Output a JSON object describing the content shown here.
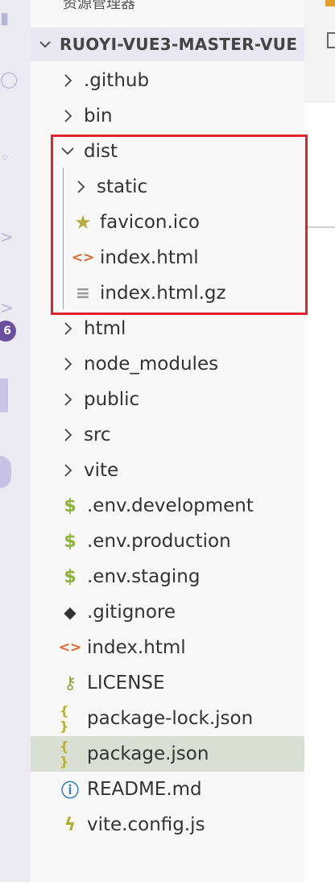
{
  "sidebar": {
    "title": "资源管理器",
    "section_title": "RUOYI-VUE3-MASTER-VUE"
  },
  "activity_bar": {
    "badge_count": "6"
  },
  "tree": [
    {
      "label": ".github",
      "type": "folder",
      "expanded": false,
      "level": 0
    },
    {
      "label": "bin",
      "type": "folder",
      "expanded": false,
      "level": 0
    },
    {
      "label": "dist",
      "type": "folder",
      "expanded": true,
      "level": 0
    },
    {
      "label": "static",
      "type": "folder",
      "expanded": false,
      "level": 1
    },
    {
      "label": "favicon.ico",
      "type": "file",
      "icon": "star-icon",
      "level": 1
    },
    {
      "label": "index.html",
      "type": "file",
      "icon": "html-code-icon",
      "level": 1
    },
    {
      "label": "index.html.gz",
      "type": "file",
      "icon": "text-file-icon",
      "level": 1
    },
    {
      "label": "html",
      "type": "folder",
      "expanded": false,
      "level": 0
    },
    {
      "label": "node_modules",
      "type": "folder",
      "expanded": false,
      "level": 0
    },
    {
      "label": "public",
      "type": "folder",
      "expanded": false,
      "level": 0
    },
    {
      "label": "src",
      "type": "folder",
      "expanded": false,
      "level": 0
    },
    {
      "label": "vite",
      "type": "folder",
      "expanded": false,
      "level": 0
    },
    {
      "label": ".env.development",
      "type": "file",
      "icon": "dollar-icon",
      "level": 0
    },
    {
      "label": ".env.production",
      "type": "file",
      "icon": "dollar-icon",
      "level": 0
    },
    {
      "label": ".env.staging",
      "type": "file",
      "icon": "dollar-icon",
      "level": 0
    },
    {
      "label": ".gitignore",
      "type": "file",
      "icon": "git-icon",
      "level": 0
    },
    {
      "label": "index.html",
      "type": "file",
      "icon": "html-code-icon",
      "level": 0
    },
    {
      "label": "LICENSE",
      "type": "file",
      "icon": "license-icon",
      "level": 0
    },
    {
      "label": "package-lock.json",
      "type": "file",
      "icon": "json-icon",
      "level": 0
    },
    {
      "label": "package.json",
      "type": "file",
      "icon": "json-icon",
      "level": 0,
      "selected": true
    },
    {
      "label": "README.md",
      "type": "file",
      "icon": "info-icon",
      "level": 0
    },
    {
      "label": "vite.config.js",
      "type": "file",
      "icon": "vite-bolt-icon",
      "level": 0
    }
  ],
  "colors": {
    "highlight_box": "#e0252a",
    "dollar": "#8fb23a",
    "html_code": "#e0662b",
    "star": "#b8a93a",
    "json": "#b8b030",
    "info": "#3a7db8",
    "git": "#333333",
    "license": "#9aa040",
    "vite": "#b0b02a",
    "selected_row": "#d9dfd2",
    "badge": "#6a4f9f"
  }
}
